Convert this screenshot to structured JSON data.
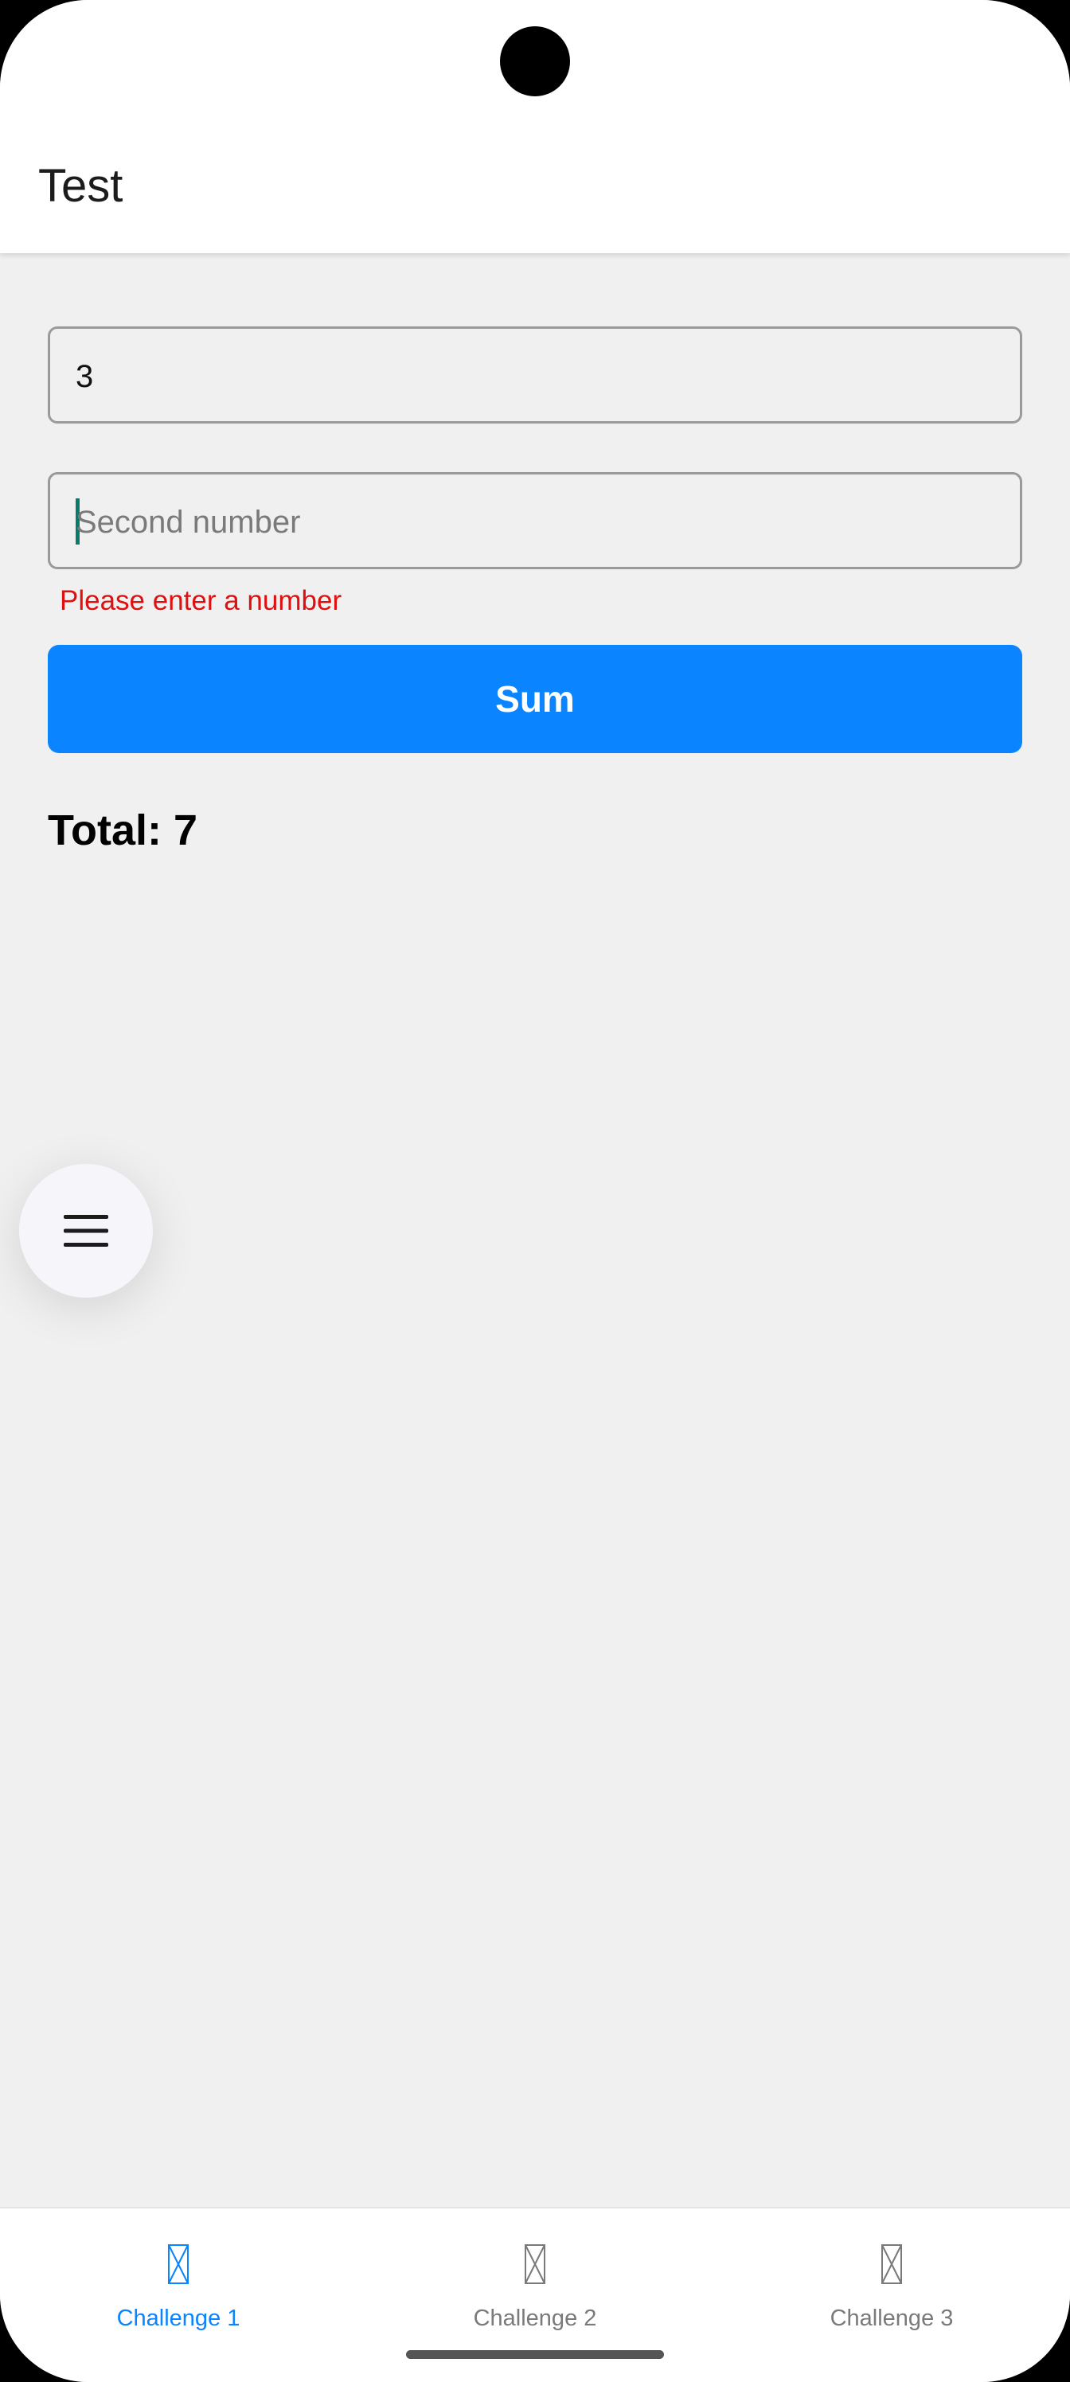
{
  "app_bar": {
    "title": "Test"
  },
  "form": {
    "first_value": "3",
    "second_placeholder": "Second number",
    "error": "Please enter a number",
    "sum_label": "Sum",
    "total": "Total: 7"
  },
  "fab": {
    "icon": "menu-icon"
  },
  "tabs": [
    {
      "label": "Challenge 1",
      "active": true,
      "icon": "missing-glyph-icon"
    },
    {
      "label": "Challenge 2",
      "active": false,
      "icon": "missing-glyph-icon"
    },
    {
      "label": "Challenge 3",
      "active": false,
      "icon": "missing-glyph-icon"
    }
  ],
  "colors": {
    "accent": "#0a84ff",
    "error": "#e01010",
    "inactive_tab": "#7a7a7a",
    "background": "#f0f0f0"
  }
}
